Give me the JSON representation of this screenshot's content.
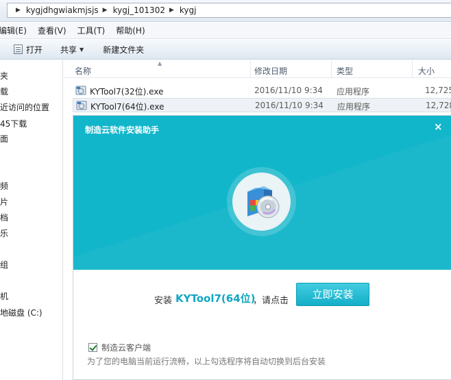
{
  "address_bar": {
    "path": [
      "kygjdhgwiakmjsjs",
      "kygj_101302",
      "kygj"
    ]
  },
  "menu": [
    "编辑(E)",
    "查看(V)",
    "工具(T)",
    "帮助(H)"
  ],
  "toolbar": {
    "open_label": "打开",
    "share_label": "共享",
    "new_folder_label": "新建文件夹"
  },
  "nav_items": [
    "夹",
    "载",
    "近访问的位置",
    "45下载",
    "面",
    "频",
    "片",
    "档",
    "乐",
    "组",
    "机",
    "地磁盘 (C:)"
  ],
  "columns": {
    "name": "名称",
    "date": "修改日期",
    "type": "类型",
    "size": "大小"
  },
  "files": [
    {
      "name": "KYTool7(32位).exe",
      "date": "2016/11/10 9:34",
      "type": "应用程序",
      "size": "12,725"
    },
    {
      "name": "KYTool7(64位).exe",
      "date": "2016/11/10 9:34",
      "type": "应用程序",
      "size": "12,728"
    }
  ],
  "dialog": {
    "title": "制造云软件安装助手",
    "close_glyph": "×",
    "install_prefix": "安装",
    "install_app": "KYTool7(64位)",
    "install_suffix": "，请点击",
    "install_button": "立即安装",
    "option_label": "制造云客户端",
    "option_checked": true,
    "option_hint": "为了您的电脑当前运行流畅，以上勾选程序将自动切换到后台安装"
  },
  "colors": {
    "accent": "#12b6ca",
    "app_name": "#11a6c3"
  }
}
